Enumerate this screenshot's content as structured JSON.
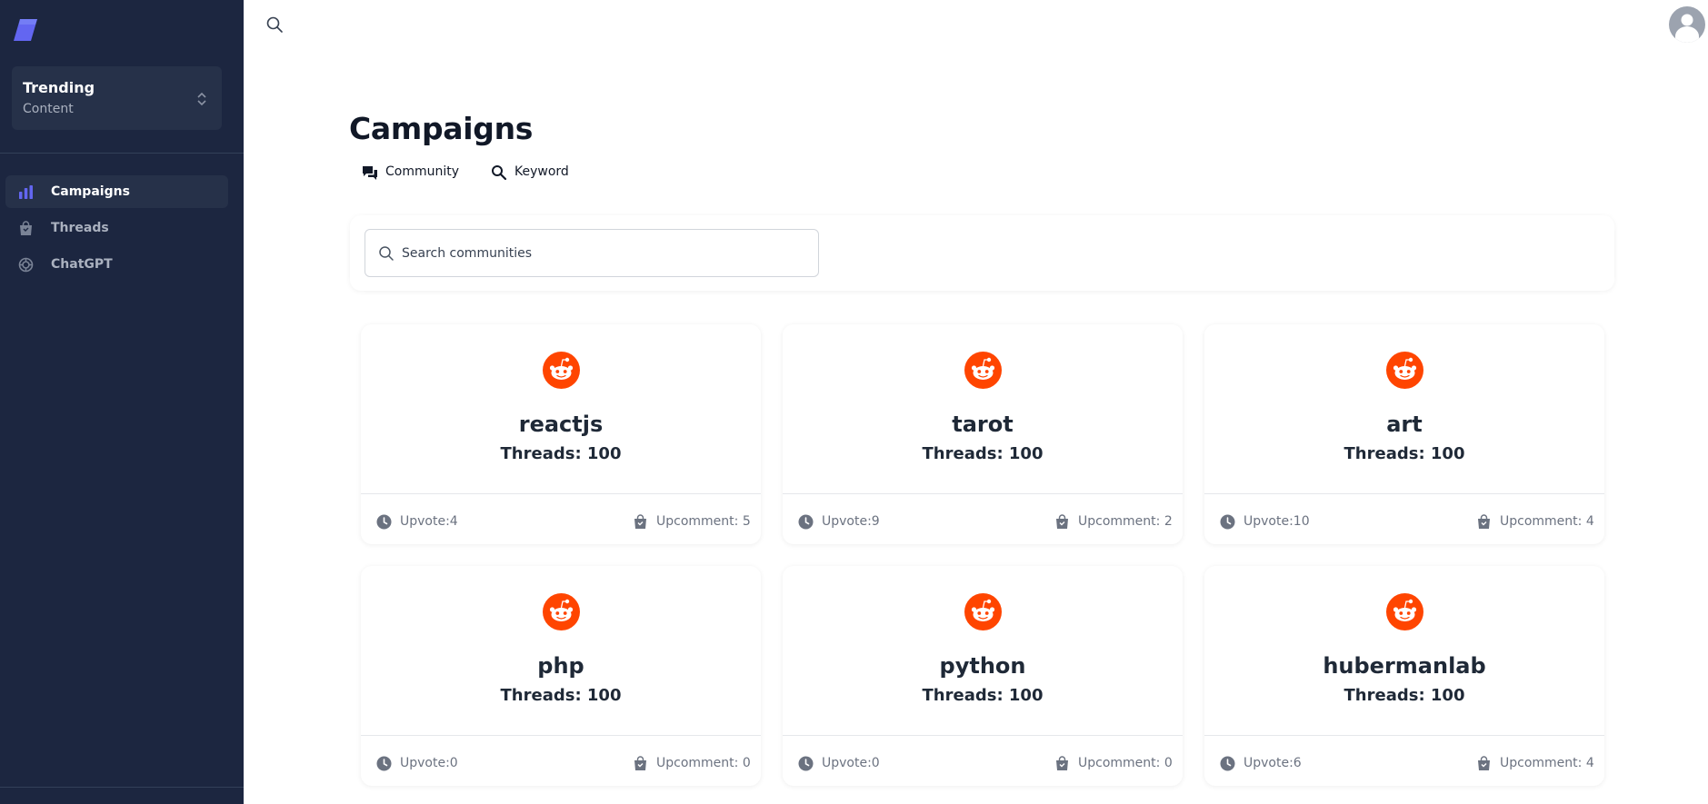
{
  "sidebar": {
    "switcher": {
      "title": "Trending",
      "subtitle": "Content"
    },
    "items": [
      {
        "label": "Campaigns",
        "icon": "bar-chart-icon",
        "active": true
      },
      {
        "label": "Threads",
        "icon": "shopping-bag-icon",
        "active": false
      },
      {
        "label": "ChatGPT",
        "icon": "chatgpt-icon",
        "active": false
      }
    ]
  },
  "main": {
    "title": "Campaigns",
    "tabs": [
      {
        "label": "Community",
        "icon": "chat-bubbles-icon"
      },
      {
        "label": "Keyword",
        "icon": "search-icon"
      }
    ],
    "search": {
      "placeholder": "Search communities",
      "value": ""
    },
    "cards": [
      {
        "name": "reactjs",
        "threads": "Threads: 100",
        "upvote": "Upvote:4",
        "upcomment": "Upcomment: 5"
      },
      {
        "name": "tarot",
        "threads": "Threads: 100",
        "upvote": "Upvote:9",
        "upcomment": "Upcomment: 2"
      },
      {
        "name": "art",
        "threads": "Threads: 100",
        "upvote": "Upvote:10",
        "upcomment": "Upcomment: 4"
      },
      {
        "name": "php",
        "threads": "Threads: 100",
        "upvote": "Upvote:0",
        "upcomment": "Upcomment: 0"
      },
      {
        "name": "python",
        "threads": "Threads: 100",
        "upvote": "Upvote:0",
        "upcomment": "Upcomment: 0"
      },
      {
        "name": "hubermanlab",
        "threads": "Threads: 100",
        "upvote": "Upvote:6",
        "upcomment": "Upcomment: 4"
      }
    ]
  },
  "colors": {
    "sidebar_bg": "#1c2640",
    "accent": "#6366f1",
    "reddit": "#ff4500"
  }
}
